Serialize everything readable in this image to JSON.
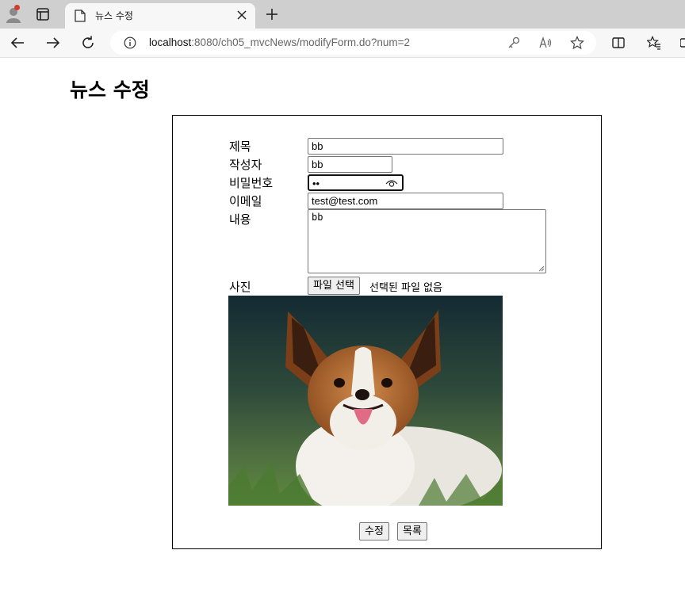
{
  "browser": {
    "tab": {
      "title": "뉴스 수정"
    },
    "address": {
      "host": "localhost",
      "path": ":8080/ch05_mvcNews/modifyForm.do?num=2"
    },
    "icons": {
      "profile": "profile-icon",
      "tabs": "tab-actions-icon",
      "doc": "document-icon",
      "close": "close-icon",
      "newtab": "plus-icon",
      "back": "back-arrow-icon",
      "forward": "forward-arrow-icon",
      "reload": "reload-icon",
      "info": "info-icon",
      "key": "key-icon",
      "read_aloud": "read-aloud-icon",
      "favorite": "star-icon",
      "split": "split-screen-icon",
      "favorites": "favorites-icon"
    }
  },
  "page": {
    "title": "뉴스 수정",
    "form": {
      "labels": {
        "title": "제목",
        "writer": "작성자",
        "password": "비밀번호",
        "email": "이메일",
        "content": "내용",
        "photo": "사진"
      },
      "values": {
        "title": "bb",
        "writer": "bb",
        "password": "••",
        "email": "test@test.com",
        "content": "bb"
      },
      "file": {
        "button": "파일 선택",
        "status": "선택된 파일 없음"
      },
      "buttons": {
        "submit": "수정",
        "list": "목록"
      }
    }
  }
}
